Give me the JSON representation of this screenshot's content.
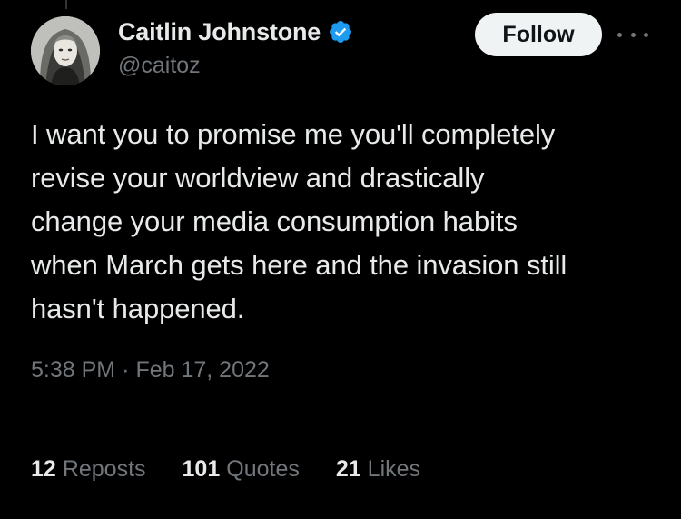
{
  "author": {
    "display_name": "Caitlin Johnstone",
    "handle": "@caitoz",
    "verified": true
  },
  "follow_label": "Follow",
  "tweet": {
    "lines": [
      "I want you to promise me you'll completely",
      "revise your worldview and drastically",
      "change your media consumption habits",
      "when March gets here and the invasion still",
      "hasn't happened."
    ]
  },
  "meta": {
    "time": "5:38 PM",
    "separator": "·",
    "date": "Feb 17, 2022"
  },
  "stats": [
    {
      "count": "12",
      "label": "Reposts"
    },
    {
      "count": "101",
      "label": "Quotes"
    },
    {
      "count": "21",
      "label": "Likes"
    }
  ],
  "colors": {
    "background": "#000000",
    "text": "#e7e9ea",
    "secondary": "#71767b",
    "verified": "#1d9bf0",
    "follow_bg": "#eff3f4"
  },
  "icons": {
    "verified": "verified-badge-icon",
    "more": "more-options-icon"
  }
}
